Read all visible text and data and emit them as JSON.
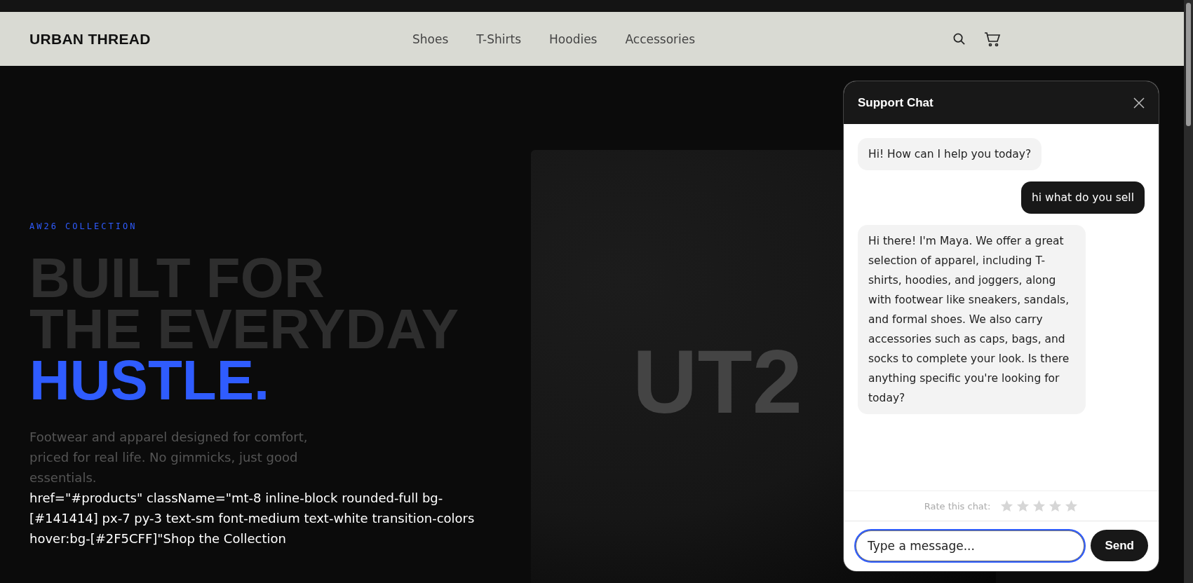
{
  "brand": "URBAN THREAD",
  "nav": [
    {
      "label": "Shoes"
    },
    {
      "label": "T-Shirts"
    },
    {
      "label": "Hoodies"
    },
    {
      "label": "Accessories"
    }
  ],
  "hero": {
    "eyebrow": "AW26 COLLECTION",
    "headline_lines": [
      "BUILT FOR",
      "THE EVERYDAY"
    ],
    "headline_accent": "HUSTLE.",
    "description": "Footwear and apparel designed for comfort, priced for real life. No gimmicks, just good essentials.",
    "raw_link_text": "href=\"#products\" className=\"mt-8 inline-block rounded-full bg-[#141414] px-7 py-3 text-sm font-medium text-white transition-colors hover:bg-[#2F5CFF]\"Shop the Collection",
    "image_text": "UT2"
  },
  "chat": {
    "title": "Support Chat",
    "messages": [
      {
        "kind": "bot",
        "text": "Hi! How can I help you today?"
      },
      {
        "kind": "user",
        "text": "hi what do you sell"
      },
      {
        "kind": "bot",
        "text": "Hi there! I'm Maya. We offer a great selection of apparel, including T-shirts, hoodies, and joggers, along with footwear like sneakers, sandals, and formal shoes. We also carry accessories such as caps, bags, and socks to complete your look. Is there anything specific you're looking for today?"
      }
    ],
    "rating_label": "Rate this chat:",
    "stars": 0,
    "input": {
      "placeholder": "Type a message..."
    },
    "send": "Send"
  }
}
